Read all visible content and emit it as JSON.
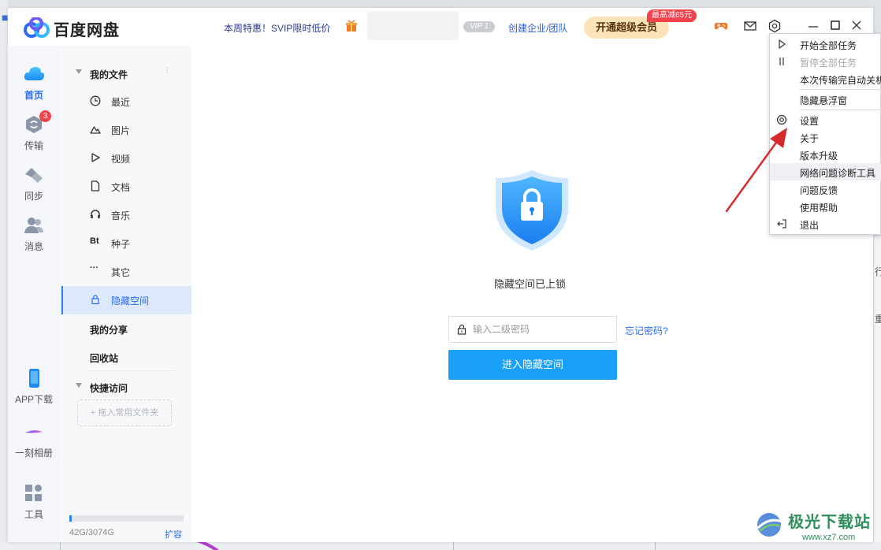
{
  "app": {
    "name": "百度网盘"
  },
  "titlebar": {
    "promo": "本周特惠！SVIP限时低价",
    "vip_badge": "VIP 1",
    "enterprise": "创建企业/团队",
    "svip_button": "开通超级会员",
    "discount_tag": "最高减65元",
    "icons": [
      "gamepad-icon",
      "mail-icon",
      "settings-icon"
    ],
    "window_controls": [
      "minimize-icon",
      "maximize-icon",
      "close-icon"
    ]
  },
  "leftnav": {
    "items": [
      {
        "label": "首页",
        "icon": "cloud-icon",
        "active": true
      },
      {
        "label": "传输",
        "icon": "transfer-icon",
        "badge": "3"
      },
      {
        "label": "同步",
        "icon": "sync-icon"
      },
      {
        "label": "消息",
        "icon": "contacts-icon"
      }
    ],
    "bottom": [
      {
        "label": "APP下载",
        "icon": "phone-icon"
      },
      {
        "label": "一刻相册",
        "icon": "album-icon"
      },
      {
        "label": "工具",
        "icon": "tools-icon"
      }
    ]
  },
  "sidebar": {
    "my_files": "我的文件",
    "items": [
      {
        "label": "最近",
        "icon": "clock-icon"
      },
      {
        "label": "图片",
        "icon": "image-icon"
      },
      {
        "label": "视频",
        "icon": "play-icon"
      },
      {
        "label": "文档",
        "icon": "document-icon"
      },
      {
        "label": "音乐",
        "icon": "headphones-icon"
      },
      {
        "label": "种子",
        "icon": "bt-icon",
        "glyph": "Bt"
      },
      {
        "label": "其它",
        "icon": "more-icon",
        "glyph": "···"
      },
      {
        "label": "隐藏空间",
        "icon": "lock-icon",
        "active": true
      }
    ],
    "my_share": "我的分享",
    "recycle": "回收站",
    "quick_access": "快捷访问",
    "drop_hint": "+ 拖入常用文件夹",
    "storage": {
      "text": "42G/3074G",
      "used_fraction": 0.014,
      "expand": "扩容"
    }
  },
  "main": {
    "locked_title": "隐藏空间已上锁",
    "password_placeholder": "输入二级密码",
    "password_value": "",
    "forgot": "忘记密码?",
    "enter_button": "进入隐藏空间"
  },
  "menu": {
    "items": [
      {
        "label": "开始全部任务",
        "icon": "play-outline-icon"
      },
      {
        "label": "暂停全部任务",
        "icon": "pause-icon",
        "disabled": true
      },
      {
        "label": "本次传输完自动关机"
      },
      {
        "label": "隐藏悬浮窗"
      },
      {
        "label": "设置",
        "icon": "gear-icon"
      },
      {
        "label": "关于"
      },
      {
        "label": "版本升级"
      },
      {
        "label": "网络问题诊断工具",
        "hover": true
      },
      {
        "label": "问题反馈"
      },
      {
        "label": "使用帮助"
      },
      {
        "label": "退出",
        "icon": "exit-icon"
      }
    ]
  },
  "watermark": {
    "text": "极光下载站",
    "url": "www.xz7.com"
  },
  "background": {
    "right_snippets": [
      "行",
      "重"
    ]
  },
  "colors": {
    "accent": "#2a6df4",
    "primary_button": "#1aa1f7",
    "badge": "#f0434b",
    "svip_bg": "#fde3b8"
  }
}
